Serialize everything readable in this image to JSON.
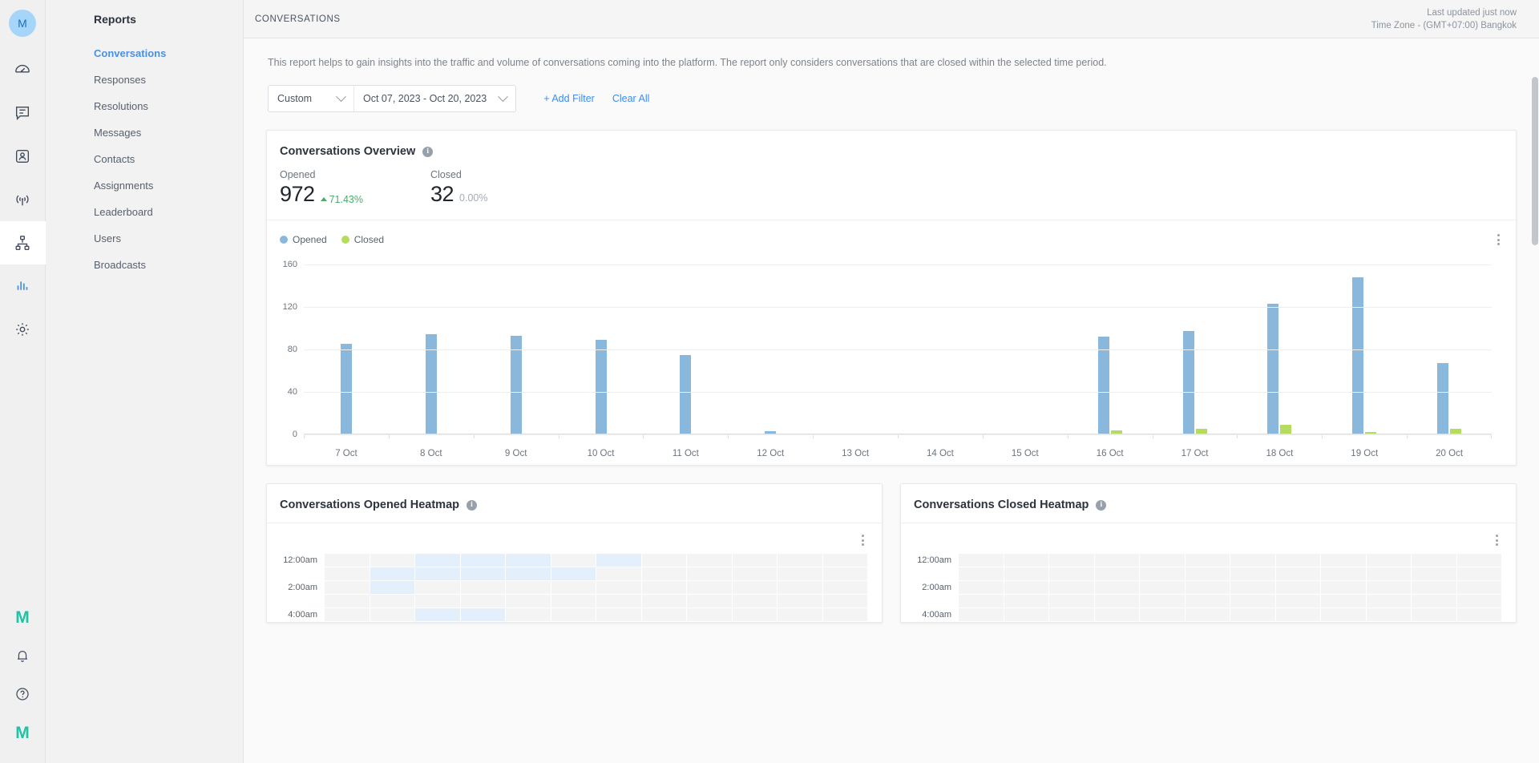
{
  "rail": {
    "avatar_initial": "M",
    "icons": [
      {
        "name": "dashboard-speedometer-icon",
        "label": "Dashboard"
      },
      {
        "name": "conversations-chat-icon",
        "label": "Conversations"
      },
      {
        "name": "contacts-card-icon",
        "label": "Contacts"
      },
      {
        "name": "broadcasts-antenna-icon",
        "label": "Broadcasts"
      },
      {
        "name": "workflows-sitemap-icon",
        "label": "Workflows"
      },
      {
        "name": "reports-bars-icon",
        "label": "Reports"
      },
      {
        "name": "settings-gear-icon",
        "label": "Settings"
      }
    ],
    "bottom_icons": [
      {
        "name": "brand-m-icon",
        "label": "M"
      },
      {
        "name": "notifications-bell-icon",
        "label": "Notifications"
      },
      {
        "name": "help-question-icon",
        "label": "Help"
      },
      {
        "name": "brand-m-secondary-icon",
        "label": "M"
      }
    ]
  },
  "sidebar": {
    "title": "Reports",
    "items": [
      {
        "label": "Conversations",
        "active": true
      },
      {
        "label": "Responses",
        "active": false
      },
      {
        "label": "Resolutions",
        "active": false
      },
      {
        "label": "Messages",
        "active": false
      },
      {
        "label": "Contacts",
        "active": false
      },
      {
        "label": "Assignments",
        "active": false
      },
      {
        "label": "Leaderboard",
        "active": false
      },
      {
        "label": "Users",
        "active": false
      },
      {
        "label": "Broadcasts",
        "active": false
      }
    ]
  },
  "topbar": {
    "breadcrumb": "CONVERSATIONS",
    "last_updated": "Last updated just now",
    "timezone": "Time Zone - (GMT+07:00) Bangkok"
  },
  "description": "This report helps to gain insights into the traffic and volume of conversations coming into the platform. The report only considers conversations that are closed within the selected time period.",
  "filters": {
    "range_preset": "Custom",
    "date_range": "Oct 07, 2023 - Oct 20, 2023",
    "add_filter_label": "+ Add Filter",
    "clear_all_label": "Clear All"
  },
  "overview": {
    "title": "Conversations Overview",
    "info_glyph": "i",
    "opened": {
      "label": "Opened",
      "value": "972",
      "delta": "71.43%",
      "direction": "up"
    },
    "closed": {
      "label": "Closed",
      "value": "32",
      "delta": "0.00%",
      "direction": "flat"
    }
  },
  "heatmaps": [
    {
      "title": "Conversations Opened Heatmap",
      "info_glyph": "i",
      "y_labels": [
        "12:00am",
        "",
        "2:00am",
        "",
        "4:00am"
      ],
      "columns": 12,
      "rows": [
        [
          0,
          0,
          1,
          1,
          1,
          0,
          1,
          0,
          0,
          0,
          0,
          0
        ],
        [
          0,
          1,
          1,
          1,
          1,
          1,
          0,
          0,
          0,
          0,
          0,
          0
        ],
        [
          0,
          1,
          0,
          0,
          0,
          0,
          0,
          0,
          0,
          0,
          0,
          0
        ],
        [
          0,
          0,
          0,
          0,
          0,
          0,
          0,
          0,
          0,
          0,
          0,
          0
        ],
        [
          0,
          0,
          1,
          1,
          0,
          0,
          0,
          0,
          0,
          0,
          0,
          0
        ]
      ]
    },
    {
      "title": "Conversations Closed Heatmap",
      "info_glyph": "i",
      "y_labels": [
        "12:00am",
        "",
        "2:00am",
        "",
        "4:00am"
      ],
      "columns": 12,
      "rows": [
        [
          0,
          0,
          0,
          0,
          0,
          0,
          0,
          0,
          0,
          0,
          0,
          0
        ],
        [
          0,
          0,
          0,
          0,
          0,
          0,
          0,
          0,
          0,
          0,
          0,
          0
        ],
        [
          0,
          0,
          0,
          0,
          0,
          0,
          0,
          0,
          0,
          0,
          0,
          0
        ],
        [
          0,
          0,
          0,
          0,
          0,
          0,
          0,
          0,
          0,
          0,
          0,
          0
        ],
        [
          0,
          0,
          0,
          0,
          0,
          0,
          0,
          0,
          0,
          0,
          0,
          0
        ]
      ]
    }
  ],
  "colors": {
    "opened": "#8ab8dc",
    "closed": "#b4dd5f",
    "accent": "#3d8bf2",
    "positive": "#4aab6b",
    "brand": "#1fc2a2"
  },
  "chart_data": {
    "type": "bar",
    "title": "Conversations Overview",
    "xlabel": "",
    "ylabel": "",
    "ylim": [
      0,
      160
    ],
    "yticks": [
      0,
      40,
      80,
      120,
      160
    ],
    "grid": true,
    "legend_position": "top-left",
    "categories": [
      "7 Oct",
      "8 Oct",
      "9 Oct",
      "10 Oct",
      "11 Oct",
      "12 Oct",
      "13 Oct",
      "14 Oct",
      "15 Oct",
      "16 Oct",
      "17 Oct",
      "18 Oct",
      "19 Oct",
      "20 Oct"
    ],
    "series": [
      {
        "name": "Opened",
        "color": "#8ab8dc",
        "values": [
          85,
          94,
          93,
          89,
          75,
          3,
          0,
          0,
          0,
          92,
          97,
          123,
          148,
          67
        ]
      },
      {
        "name": "Closed",
        "color": "#b4dd5f",
        "values": [
          0,
          0,
          0,
          0,
          0,
          0,
          0,
          0,
          0,
          4,
          5,
          9,
          2,
          5
        ]
      }
    ]
  }
}
